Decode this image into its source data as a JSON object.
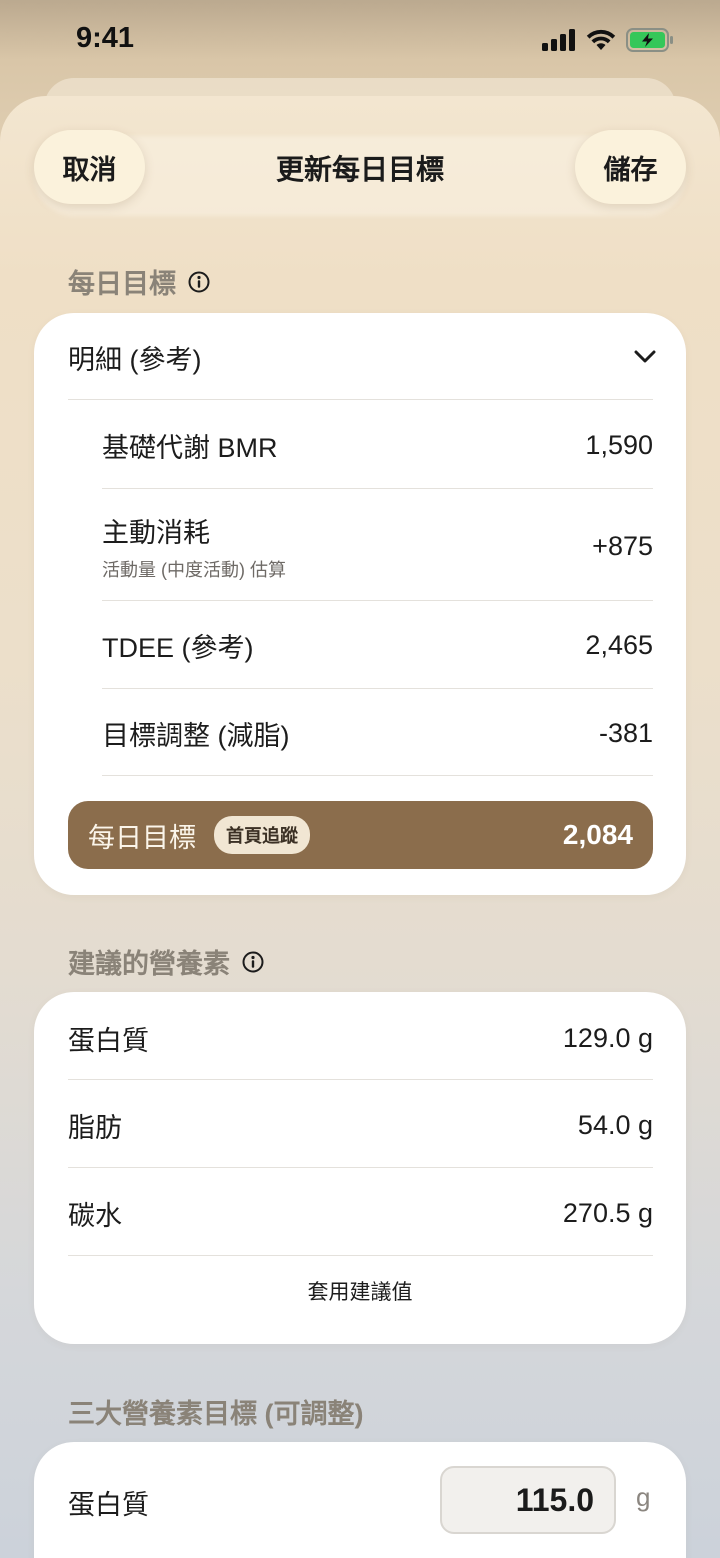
{
  "status_bar": {
    "time": "9:41"
  },
  "nav": {
    "cancel_label": "取消",
    "title": "更新每日目標",
    "save_label": "儲存"
  },
  "daily_goal": {
    "section_title": "每日目標",
    "breakdown_label": "明細 (參考)",
    "rows": [
      {
        "label": "基礎代謝 BMR",
        "value": "1,590"
      },
      {
        "label": "主動消耗",
        "sublabel": "活動量 (中度活動) 估算",
        "value": "+875"
      },
      {
        "label": "TDEE (參考)",
        "value": "2,465"
      },
      {
        "label": "目標調整 (減脂)",
        "value": "-381"
      }
    ],
    "total": {
      "label": "每日目標",
      "badge": "首頁追蹤",
      "value": "2,084"
    }
  },
  "suggested_nutrients": {
    "section_title": "建議的營養素",
    "rows": [
      {
        "label": "蛋白質",
        "value": "129.0 g"
      },
      {
        "label": "脂肪",
        "value": "54.0 g"
      },
      {
        "label": "碳水",
        "value": "270.5 g"
      }
    ],
    "apply_label": "套用建議值"
  },
  "macro_targets": {
    "section_title": "三大營養素目標 (可調整)",
    "rows": [
      {
        "label": "蛋白質",
        "value": "115.0",
        "unit": "g"
      }
    ]
  },
  "colors": {
    "accent_brown": "#8b6d4c",
    "battery_green": "#35c759"
  }
}
